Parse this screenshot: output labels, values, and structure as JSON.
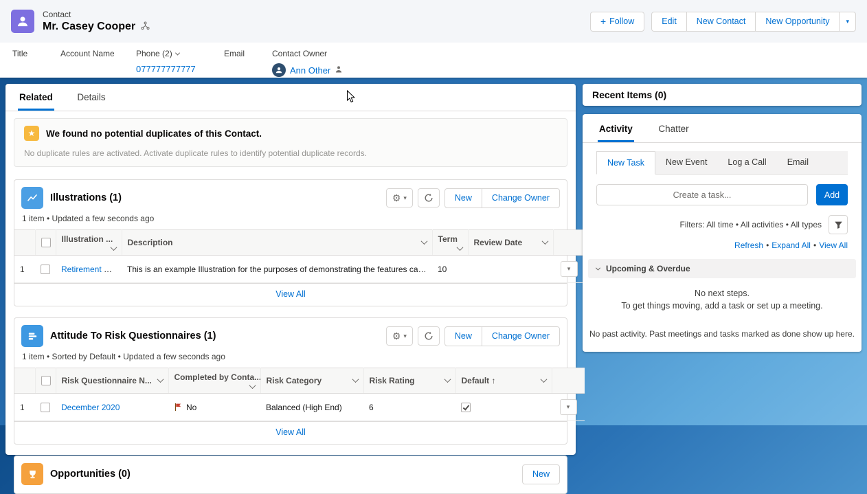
{
  "colors": {
    "link": "#0070d2",
    "brand_button": "#0070d2",
    "contact_icon": "#7d6fe0",
    "illustrations_icon": "#4b9fe4",
    "questionnaires_icon": "#3d98e2",
    "opportunities_icon": "#f5a13d",
    "duplicate_icon": "#f7b93f",
    "flag": "#c8402f",
    "background_gradient": [
      "#0e4c8a",
      "#2a72b5",
      "#74b7e4"
    ]
  },
  "icons": {
    "plus": "+",
    "caret": "▾",
    "gear": "⚙",
    "star": "★"
  },
  "app_header": {
    "object_label": "Contact",
    "record_name": "Mr. Casey Cooper",
    "follow_button": "Follow",
    "action_buttons": [
      "Edit",
      "New Contact",
      "New Opportunity"
    ]
  },
  "details_bar": {
    "fields": [
      {
        "label": "Title",
        "value": ""
      },
      {
        "label": "Account Name",
        "value": ""
      },
      {
        "label": "Phone (2)",
        "value": "077777777777"
      },
      {
        "label": "Email",
        "value": ""
      },
      {
        "label": "Contact Owner",
        "value": "Ann Other"
      }
    ]
  },
  "tabs": {
    "related": "Related",
    "details": "Details"
  },
  "duplicates": {
    "title": "We found no potential duplicates of this Contact.",
    "description": "No duplicate rules are activated. Activate duplicate rules to identify potential duplicate records."
  },
  "illustrations": {
    "title": "Illustrations (1)",
    "meta": "1 item • Updated a few seconds ago",
    "new_button": "New",
    "change_owner_button": "Change Owner",
    "columns": [
      "Illustration ...",
      "Description",
      "Term",
      "Review Date"
    ],
    "rows": [
      {
        "index": "1",
        "name": "Retirement Plan",
        "description": "This is an example Illustration for the purposes of demonstrating the features capabilities",
        "term": "10",
        "review_date": ""
      }
    ],
    "view_all": "View All"
  },
  "questionnaires": {
    "title": "Attitude To Risk Questionnaires (1)",
    "meta": "1 item • Sorted by Default • Updated a few seconds ago",
    "new_button": "New",
    "change_owner_button": "Change Owner",
    "columns": [
      "Risk Questionnaire N...",
      "Completed by Conta...",
      "Risk Category",
      "Risk Rating",
      "Default"
    ],
    "sort_arrow": "↑",
    "rows": [
      {
        "index": "1",
        "name": "December 2020",
        "completed_by": "No",
        "category": "Balanced (High End)",
        "rating": "6",
        "default": true
      }
    ],
    "view_all": "View All"
  },
  "opportunities": {
    "title": "Opportunities (0)",
    "new_button": "New"
  },
  "recent_items": {
    "title": "Recent Items (0)"
  },
  "activity": {
    "tab_activity": "Activity",
    "tab_chatter": "Chatter",
    "subtabs": [
      "New Task",
      "New Event",
      "Log a Call",
      "Email"
    ],
    "composer_placeholder": "Create a task...",
    "add_button": "Add",
    "filters_summary": "Filters: All time • All activities • All types",
    "links": [
      "Refresh",
      "Expand All",
      "View All"
    ],
    "link_separator": "•",
    "section_title": "Upcoming & Overdue",
    "no_next_steps": "No next steps.",
    "no_next_steps_hint": "To get things moving, add a task or set up a meeting.",
    "no_past_activity": "No past activity. Past meetings and tasks marked as done show up here."
  }
}
